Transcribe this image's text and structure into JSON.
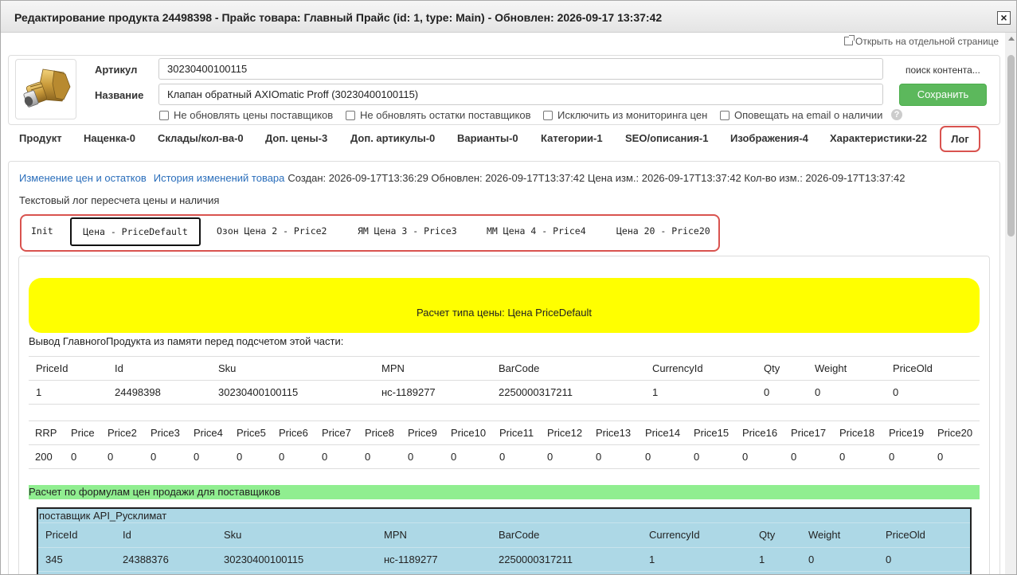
{
  "window": {
    "title": "Редактирование продукта 24498398 - Прайс товара: Главный Прайс (id: 1, type: Main) - Обновлен: 2026-09-17 13:37:42",
    "close_label": "×",
    "open_separate": "Открыть на отдельной странице"
  },
  "product": {
    "article_label": "Артикул",
    "article_value": "30230400100115",
    "name_label": "Название",
    "name_value": "Клапан обратный AXIOmatic Proff (30230400100115)",
    "search_content": "поиск контента...",
    "save_label": "Сохранить",
    "checkboxes": [
      "Не обновлять цены поставщиков",
      "Не обновлять остатки поставщиков",
      "Исключить из мониторинга цен",
      "Оповещать на email о наличии"
    ],
    "help": "?"
  },
  "tabs": [
    "Продукт",
    "Наценка-0",
    "Склады/кол-ва-0",
    "Доп. цены-3",
    "Доп. артикулы-0",
    "Варианты-0",
    "Категории-1",
    "SEO/описания-1",
    "Изображения-4",
    "Характеристики-22",
    "Лог"
  ],
  "log": {
    "link_changes": "Изменение цен и остатков",
    "link_history": "История изменений товара",
    "meta": "Создан: 2026-09-17T13:36:29 Обновлен: 2026-09-17T13:37:42 Цена изм.: 2026-09-17T13:37:42 Кол-во изм.: 2026-09-17T13:37:42",
    "title": "Текстовый лог пересчета цены и наличия",
    "subtabs": [
      "Init",
      "Цена - PriceDefault",
      "Озон Цена 2 - Price2",
      "ЯМ Цена 3 - Price3",
      "ММ Цена 4 - Price4",
      "Цена 20 - Price20"
    ],
    "calc_banner": "Расчет типа цены: Цена PriceDefault",
    "main_product_caption": "Вывод ГлавногоПродукта из памяти перед подсчетом этой части:",
    "table1": {
      "headers": [
        "PriceId",
        "Id",
        "Sku",
        "MPN",
        "BarCode",
        "CurrencyId",
        "Qty",
        "Weight",
        "PriceOld"
      ],
      "row": [
        "1",
        "24498398",
        "30230400100115",
        "нс-1189277",
        "2250000317211",
        "1",
        "0",
        "0",
        "0"
      ]
    },
    "table2": {
      "headers": [
        "RRP",
        "Price",
        "Price2",
        "Price3",
        "Price4",
        "Price5",
        "Price6",
        "Price7",
        "Price8",
        "Price9",
        "Price10",
        "Price11",
        "Price12",
        "Price13",
        "Price14",
        "Price15",
        "Price16",
        "Price17",
        "Price18",
        "Price19",
        "Price20"
      ],
      "row": [
        "200",
        "0",
        "0",
        "0",
        "0",
        "0",
        "0",
        "0",
        "0",
        "0",
        "0",
        "0",
        "0",
        "0",
        "0",
        "0",
        "0",
        "0",
        "0",
        "0",
        "0"
      ]
    },
    "supplier_section": "Расчет по формулам цен продажи для поставщиков",
    "supplier": {
      "name": "поставщик API_Русклимат",
      "headers": [
        "PriceId",
        "Id",
        "Sku",
        "MPN",
        "BarCode",
        "CurrencyId",
        "Qty",
        "Weight",
        "PriceOld"
      ],
      "row": [
        "345",
        "24388376",
        "30230400100115",
        "нс-1189277",
        "2250000317211",
        "1",
        "1",
        "0",
        "0"
      ]
    }
  }
}
